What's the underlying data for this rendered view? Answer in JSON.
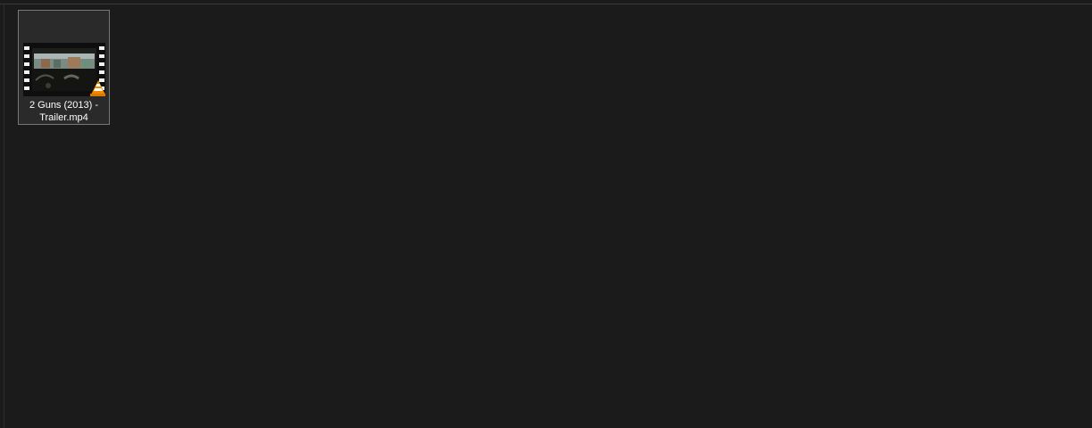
{
  "files": [
    {
      "name_line1": "2 Guns (2013) -",
      "name_line2": "Trailer.mp4",
      "thumbnail_icon": "video-film-thumbnail-icon",
      "overlay_icon": "vlc-cone-icon",
      "selected": true
    }
  ],
  "colors": {
    "background": "#1b1b1b",
    "tile_border": "#777777",
    "tile_fill": "#2a2a2a",
    "text": "#ffffff",
    "vlc_orange": "#f08a00"
  }
}
